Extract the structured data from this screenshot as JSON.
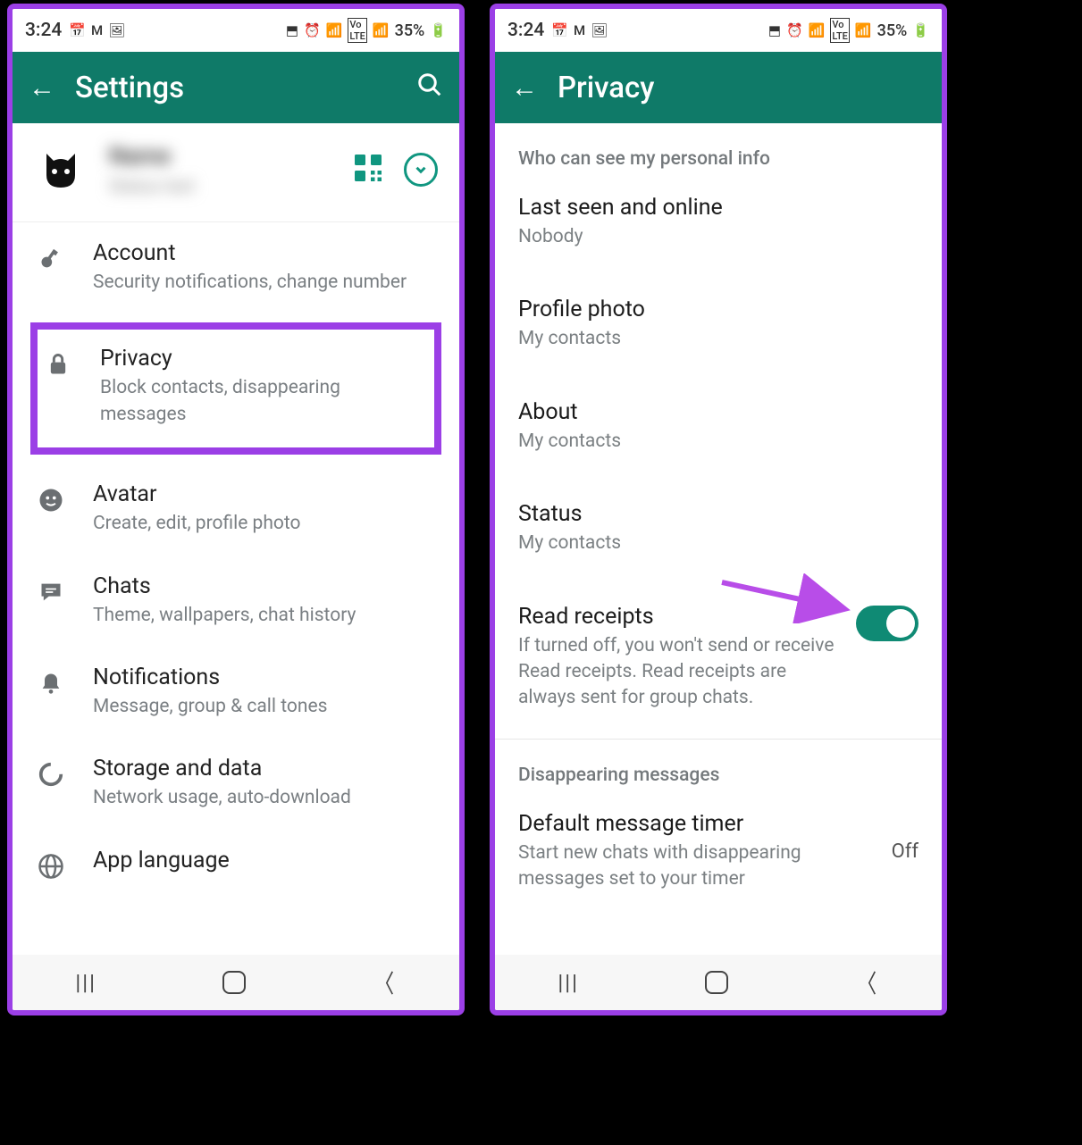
{
  "status": {
    "time": "3:24",
    "battery": "35%"
  },
  "left": {
    "appbar_title": "Settings",
    "profile_name": "Name",
    "profile_status": "Status text",
    "items": [
      {
        "title": "Account",
        "sub": "Security notifications, change number"
      },
      {
        "title": "Privacy",
        "sub": "Block contacts, disappearing messages"
      },
      {
        "title": "Avatar",
        "sub": "Create, edit, profile photo"
      },
      {
        "title": "Chats",
        "sub": "Theme, wallpapers, chat history"
      },
      {
        "title": "Notifications",
        "sub": "Message, group & call tones"
      },
      {
        "title": "Storage and data",
        "sub": "Network usage, auto-download"
      },
      {
        "title": "App language",
        "sub": ""
      }
    ]
  },
  "right": {
    "appbar_title": "Privacy",
    "section1": "Who can see my personal info",
    "items": [
      {
        "title": "Last seen and online",
        "sub": "Nobody"
      },
      {
        "title": "Profile photo",
        "sub": "My contacts"
      },
      {
        "title": "About",
        "sub": "My contacts"
      },
      {
        "title": "Status",
        "sub": "My contacts"
      }
    ],
    "read_receipts": {
      "title": "Read receipts",
      "sub": "If turned off, you won't send or receive Read receipts. Read receipts are always sent for group chats.",
      "enabled": true
    },
    "section2": "Disappearing messages",
    "timer": {
      "title": "Default message timer",
      "sub": "Start new chats with disappearing messages set to your timer",
      "value": "Off"
    }
  },
  "colors": {
    "accent": "#0f7a68",
    "highlight": "#9b3fe6"
  }
}
